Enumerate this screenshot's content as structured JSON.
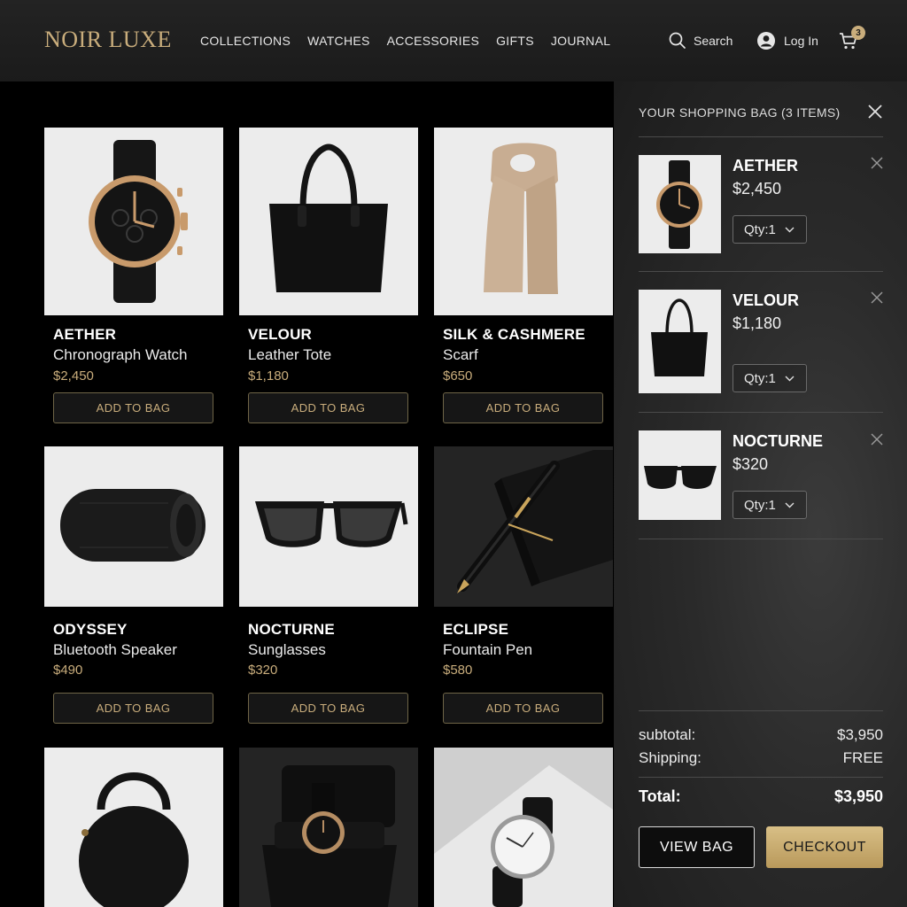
{
  "header": {
    "logo": "NOIR LUXE",
    "nav": [
      "COLLECTIONS",
      "WATCHES",
      "ACCESSORIES",
      "GIFTS",
      "JOURNAL"
    ],
    "search_label": "Search",
    "login_label": "Log In",
    "cart_count": "3"
  },
  "products": [
    {
      "brand": "AETHER",
      "desc": "Chronograph Watch",
      "price": "$2,450",
      "button": "ADD TO BAG",
      "icon": "watch-icon"
    },
    {
      "brand": "VELOUR",
      "desc": "Leather Tote",
      "price": "$1,180",
      "button": "ADD TO BAG",
      "icon": "tote-bag-icon"
    },
    {
      "brand": "SILK & CASHMERE",
      "desc": "Scarf",
      "price": "$650",
      "button": "ADD TO BAG",
      "icon": "scarf-icon"
    },
    {
      "brand": "ODYSSEY",
      "desc": "Bluetooth Speaker",
      "price": "$490",
      "button": "ADD TO BAG",
      "icon": "speaker-icon"
    },
    {
      "brand": "NOCTURNE",
      "desc": "Sunglasses",
      "price": "$320",
      "button": "ADD TO BAG",
      "icon": "sunglasses-icon"
    },
    {
      "brand": "ECLIPSE",
      "desc": "Fountain Pen",
      "price": "$580",
      "button": "ADD TO BAG",
      "icon": "pen-icon"
    },
    {
      "icon": "round-bag-icon"
    },
    {
      "icon": "watch-box-icon"
    },
    {
      "icon": "wristwatch-icon"
    }
  ],
  "bag": {
    "title": "YOUR SHOPPING BAG (3 ITEMS)",
    "items": [
      {
        "brand": "AETHER",
        "price": "$2,450",
        "qty": "Qty:1"
      },
      {
        "brand": "VELOUR",
        "price": "$1,180",
        "qty": "Qty:1"
      },
      {
        "brand": "NOCTURNE",
        "price": "$320",
        "qty": "Qty:1"
      }
    ],
    "subtotal_label": "subtotal:",
    "subtotal_value": "$3,950",
    "shipping_label": "Shipping:",
    "shipping_value": "FREE",
    "total_label": "Total:",
    "total_value": "$3,950",
    "view_bag": "VIEW BAG",
    "checkout": "CHECKOUT"
  },
  "colors": {
    "accent_gold": "#c9ad7c",
    "header_bg": "#1b1b1b",
    "page_bg": "#000000",
    "drawer_bg": "#2a2a2a"
  }
}
